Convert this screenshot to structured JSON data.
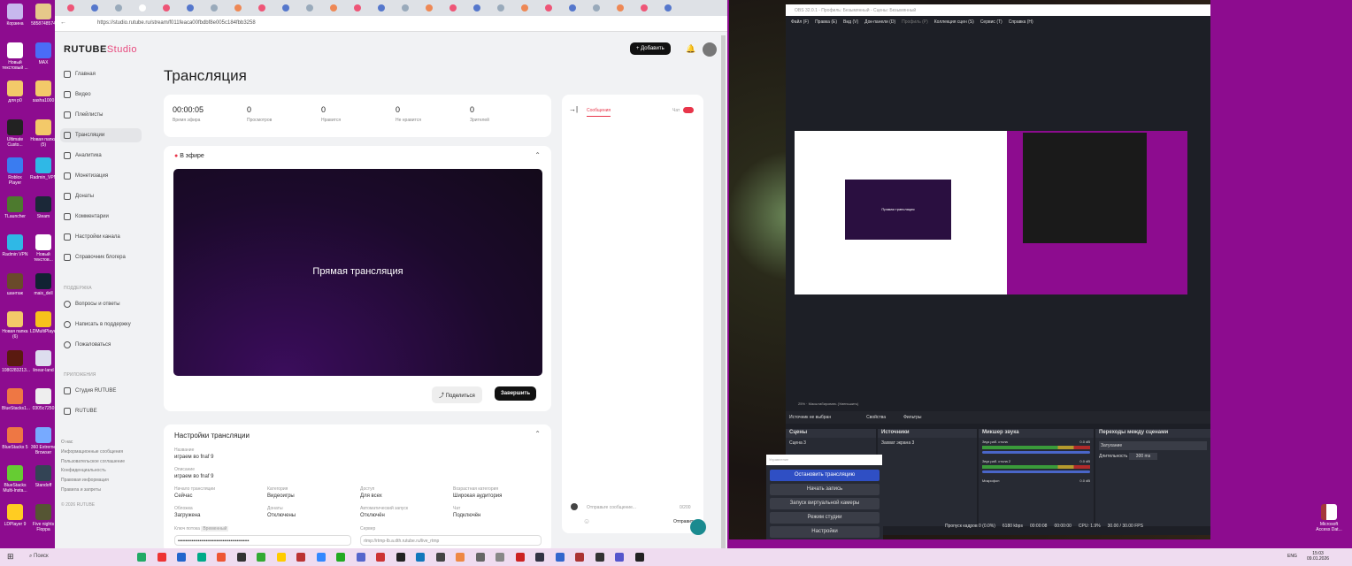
{
  "desktop": {
    "icons": [
      "Корзина",
      "5858748574",
      "Новый текстовый ...",
      "MAX",
      "для р0",
      "sasha1000",
      "Ultimate Custo...",
      "Новая папка (5)",
      "Roblox Player",
      "Radmin_VPN",
      "TLauncher",
      "Steam",
      "Radmin VPN",
      "Новый текстов...",
      "шантаж",
      "mais_dell",
      "Новая папка (6)",
      "LDMultiPlayer",
      "1080283213...",
      "linear-land",
      "BlueStacks1...",
      "0305c7250",
      "BlueStacks 5",
      "360 Extreme Browser",
      "BlueStacks Multi-Insta...",
      "Standoff",
      "LDPlayer 9",
      "Five nights Floppa"
    ],
    "right_icon": "Microsoft Access Dat..."
  },
  "browser": {
    "url": "https://studio.rutube.ru/stream/f011feaca00fbdbf8e005c184fbb3258"
  },
  "rutube": {
    "logo_main": "RUTUBE",
    "logo_sub": "Studio",
    "add_button": "Добавить",
    "nav": [
      "Главная",
      "Видео",
      "Плейлисты",
      "Трансляции",
      "Аналитика",
      "Монетизация",
      "Донаты",
      "Комментарии",
      "Настройки канала",
      "Справочник блогера"
    ],
    "support_header": "ПОДДЕРЖКА",
    "support": [
      "Вопросы и ответы",
      "Написать в поддержку",
      "Пожаловаться"
    ],
    "apps_header": "ПРИЛОЖЕНИЯ",
    "apps": [
      "Студия RUTUBE",
      "RUTUBE"
    ],
    "footer": [
      "О нас",
      "Информационные сообщения",
      "Пользовательское соглашение",
      "Конфиденциальность",
      "Правовая информация",
      "Правила и запреты"
    ],
    "copyright": "© 2026 RUTUBE",
    "page_title": "Трансляция",
    "stats": [
      {
        "value": "00:00:05",
        "label": "Время эфира"
      },
      {
        "value": "0",
        "label": "Просмотров"
      },
      {
        "value": "0",
        "label": "Нравится"
      },
      {
        "value": "0",
        "label": "Не нравится"
      },
      {
        "value": "0",
        "label": "Зрителей"
      }
    ],
    "live_label": "В эфире",
    "player_text": "Прямая трансляция",
    "share": "Поделиться",
    "finish": "Завершить",
    "settings_title": "Настройки трансляции",
    "fields": [
      {
        "label": "Название",
        "value": "играем во fnaf 9"
      },
      {
        "label": "Описание",
        "value": "играем во fnaf 9"
      }
    ],
    "grid": [
      {
        "label": "Начало трансляции",
        "value": "Сейчас"
      },
      {
        "label": "Категория",
        "value": "Видеоигры"
      },
      {
        "label": "Доступ",
        "value": "Для всех"
      },
      {
        "label": "Возрастная категория",
        "value": "Широкая аудитория"
      },
      {
        "label": "Обложка",
        "value": "Загружена"
      },
      {
        "label": "Донаты",
        "value": "Отключены"
      },
      {
        "label": "Автоматический запуск",
        "value": "Отключён"
      },
      {
        "label": "Чат",
        "value": "Подключён"
      }
    ],
    "stream_key_label": "Ключ потока",
    "stream_key_badge": "Временный",
    "server_label": "Сервер",
    "server_value": "rtmp://rtmp-lb.a.dth.rutube.ru/live_rtmp",
    "chat_tab": "Сообщения",
    "chat_toggle": "Чат",
    "chat_placeholder": "Отправьте сообщение...",
    "chat_counter": "0/200",
    "chat_send": "Отправить"
  },
  "obs": {
    "title": "OBS 32.0.1 - Профиль: Безымянный - Сцены: Безымянный",
    "menu": [
      "Файл (F)",
      "Правка (E)",
      "Вид (V)",
      "Док-панели (D)",
      "Профиль (P)",
      "Коллекция сцен (S)",
      "Сервис (T)",
      "Справка (H)"
    ],
    "preview_zoom": "25%",
    "preview_mode": "Масштабировать (Уменьшить)",
    "nested_title": "Прямая трансляция",
    "no_source": "Источник не выбран",
    "properties": "Свойства",
    "filters": "Фильтры",
    "scenes_header": "Сцены",
    "scenes": [
      "Сцена 3"
    ],
    "sources_header": "Источники",
    "sources": [
      "Захват экрана 3"
    ],
    "mixer_header": "Микшер звука",
    "mixer": [
      {
        "name": "Звук раб. стола",
        "db": "0.0 dB"
      },
      {
        "name": "Звук раб. стола 2",
        "db": "0.0 dB"
      },
      {
        "name": "Микрофон",
        "db": "0.0 dB"
      }
    ],
    "transitions_header": "Переходы между сценами",
    "transition": "Затухание",
    "duration_label": "Длительность",
    "duration": "300 ms",
    "controls_placeholder": "Управление",
    "controls": [
      "Остановить трансляцию",
      "Начать запись",
      "Запуск виртуальной камеры",
      "Режим студии",
      "Настройки"
    ],
    "status": {
      "dropped": "Пропуск кадров 0 (0.0%)",
      "bitrate": "6180 kbps",
      "stream_time": "00:00:08",
      "rec_time": "00:00:00",
      "cpu": "CPU: 1.9%",
      "fps": "30.00 / 30.00 FPS"
    }
  },
  "taskbar": {
    "search": "Поиск",
    "lang": "ENG",
    "time": "15:03",
    "date": "09.01.2026"
  },
  "colors": {
    "desktop": "#8d0c8f",
    "accent_red": "#e8354a",
    "obs_blue": "#2f4fc4"
  }
}
